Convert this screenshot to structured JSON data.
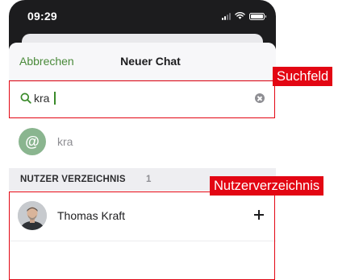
{
  "status_bar": {
    "time": "09:29",
    "icons": [
      "signal-icon",
      "wifi-icon",
      "battery-icon"
    ]
  },
  "header": {
    "cancel_label": "Abbrechen",
    "title": "Neuer Chat"
  },
  "search": {
    "value": "kra",
    "icon": "search-icon",
    "clear_icon": "clear-icon"
  },
  "mention": {
    "symbol": "@",
    "label": "kra"
  },
  "section": {
    "title": "NUTZER VERZEICHNIS",
    "count": "1"
  },
  "users": [
    {
      "name": "Thomas Kraft",
      "action_icon": "add-icon"
    }
  ],
  "annotations": {
    "search_label": "Suchfeld",
    "directory_label": "Nutzerverzeichnis"
  },
  "colors": {
    "accent": "#4a8a3a",
    "annotation": "#e30613",
    "mention_avatar": "#8ab58f"
  }
}
